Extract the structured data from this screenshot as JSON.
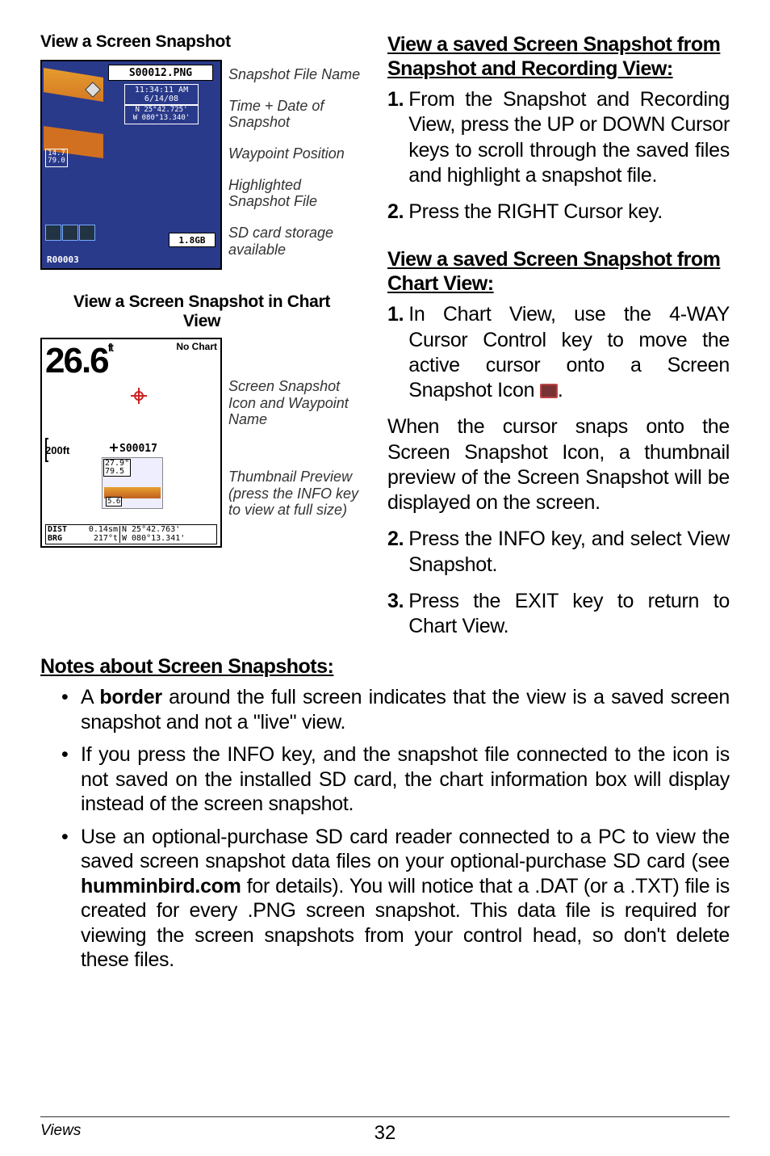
{
  "left": {
    "fig1_title": "View a Screen Snapshot",
    "fig1": {
      "file": "S00012.PNG",
      "time": "11:34:11 AM\n6/14/08",
      "pos": "N 25°42.725'\nW 080°13.340'",
      "depth_box": "14.7\n79.0",
      "storage": "1.8GB",
      "rec": "R00003"
    },
    "ann1": [
      "Snapshot File Name",
      "Time + Date of Snapshot",
      "Waypoint Position",
      "Highlighted Snapshot File",
      "SD card storage available"
    ],
    "fig2_title": "View a Screen Snapshot in Chart View",
    "fig2": {
      "depth": "26.6",
      "unit": "ft",
      "nochart": "No Chart",
      "scale": "200ft",
      "wp": "S00017",
      "thumb_vals": "27.9\"\n79.5",
      "dist_lbl": "DIST\nBRG",
      "dist_mid": "0.14sm\n217°t",
      "dist_r": "N 25°42.763'\nW 080°13.341'"
    },
    "ann2": [
      "Screen Snapshot Icon and Waypoint Name",
      "Thumbnail Preview (press the INFO key to view at full size)"
    ]
  },
  "right": {
    "h1": "View a saved Screen Snapshot from Snapshot and Recording View:",
    "s1_1": "From the Snapshot and Recording View, press the UP or DOWN Cursor keys to scroll through the saved files and highlight a snapshot file.",
    "s1_2": "Press the RIGHT Cursor key.",
    "h2": "View a saved Screen Snapshot from Chart View:",
    "s2_1a": "In Chart View, use the 4-WAY Cursor Control key to move the active cursor onto a Screen Snapshot Icon ",
    "s2_1b": ".",
    "p1": "When the cursor snaps onto the Screen Snapshot Icon, a thumbnail preview of the Screen Snapshot will be displayed on the screen.",
    "s2_2": "Press the INFO key, and select View Snapshot.",
    "s2_3": "Press the EXIT key to return to Chart View."
  },
  "notes": {
    "head": "Notes about Screen Snapshots:",
    "b1a": "A ",
    "b1b": "border",
    "b1c": " around the full screen indicates that the view is a saved screen snapshot and not a \"live\" view.",
    "b2": "If you press the INFO key, and the snapshot file connected to the icon is not saved on the installed SD card, the chart information box will display instead of the screen snapshot.",
    "b3a": "Use an optional-purchase SD card reader connected to a PC to view the saved screen snapshot data files on your optional-purchase SD card (see ",
    "b3b": "humminbird.com",
    "b3c": " for details). You will notice that a .DAT (or a .TXT) file is created for every .PNG screen snapshot. This data file is required for viewing the screen snapshots from your control head, so don't delete these files."
  },
  "footer": {
    "section": "Views",
    "page": "32"
  }
}
